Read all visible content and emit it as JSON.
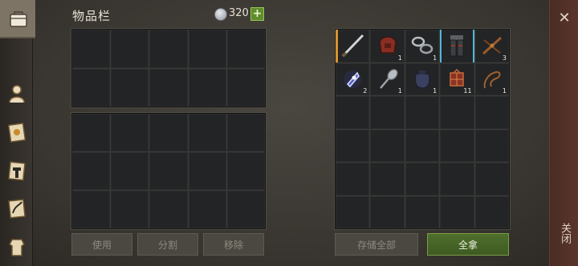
{
  "header": {
    "title": "物品栏",
    "currency_count": "320",
    "add_label": "+"
  },
  "sidebar": {
    "items": [
      {
        "icon": "backpack-icon"
      },
      {
        "icon": "character-icon"
      },
      {
        "icon": "recipe-book-icon"
      },
      {
        "icon": "crafting-hammer-icon"
      },
      {
        "icon": "scroll-icon"
      },
      {
        "icon": "armor-icon"
      }
    ]
  },
  "inventory": {
    "buttons": {
      "use": "使用",
      "split": "分割",
      "move": "移除"
    }
  },
  "storage": {
    "items": [
      {
        "icon": "sword-icon",
        "qty": ""
      },
      {
        "icon": "saddle-icon",
        "qty": "1"
      },
      {
        "icon": "chain-icon",
        "qty": "1"
      },
      {
        "icon": "leg-armor-icon",
        "qty": ""
      },
      {
        "icon": "crossbow-icon",
        "qty": "3"
      },
      {
        "icon": "crystal-icon",
        "qty": "2"
      },
      {
        "icon": "spoon-icon",
        "qty": "1"
      },
      {
        "icon": "sack-icon",
        "qty": "1"
      },
      {
        "icon": "lantern-icon",
        "qty": "11"
      },
      {
        "icon": "whip-icon",
        "qty": "1"
      }
    ],
    "buttons": {
      "store_all": "存储全部",
      "take_all": "全拿"
    }
  },
  "close": {
    "label": "关闭",
    "icon": "close-icon"
  },
  "colors": {
    "accent_green": "#5f8c2c",
    "select_orange": "#d9922e",
    "select_cyan": "#4fb8d8"
  }
}
